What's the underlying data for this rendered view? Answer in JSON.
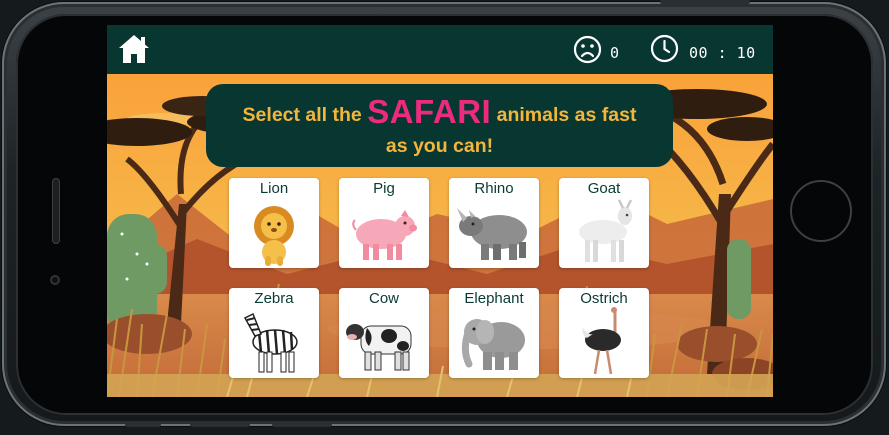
{
  "header": {
    "home_icon": "home-icon",
    "miss_icon": "sad-face-icon",
    "miss_count": "0",
    "timer_icon": "clock-icon",
    "timer": "00 : 10"
  },
  "banner": {
    "line_prefix": "Select all the",
    "highlight": "SAFARI",
    "line_suffix": "animals as fast",
    "line2": "as you can!"
  },
  "animals": [
    {
      "name": "Lion"
    },
    {
      "name": "Pig"
    },
    {
      "name": "Rhino"
    },
    {
      "name": "Goat"
    },
    {
      "name": "Zebra"
    },
    {
      "name": "Cow"
    },
    {
      "name": "Elephant"
    },
    {
      "name": "Ostrich"
    }
  ],
  "colors": {
    "topbar": "#083631",
    "banner_text": "#f3b53c",
    "highlight": "#ec2b7e",
    "card_label": "#0a3a35"
  }
}
